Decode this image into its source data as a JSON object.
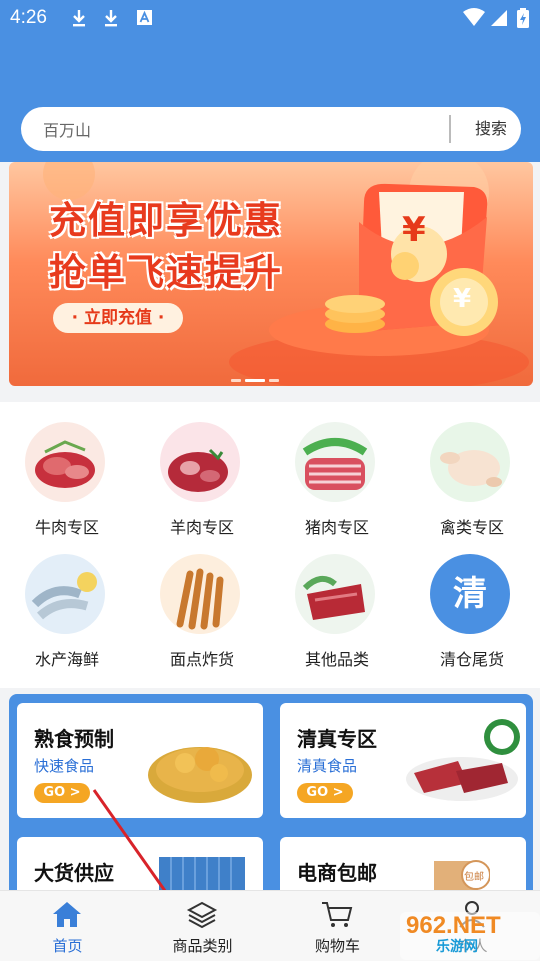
{
  "status_bar": {
    "time": "4:26",
    "icons": [
      "download-icon",
      "download-icon",
      "a-icon",
      "wifi-icon",
      "signal-icon",
      "battery-icon"
    ]
  },
  "search": {
    "placeholder": "百万山",
    "button": "搜索"
  },
  "banner": {
    "line1": "充值即享优惠",
    "line2": "抢单飞速提升",
    "cta": "· 立即充值 ·",
    "coin_symbol": "¥"
  },
  "categories": [
    {
      "label": "牛肉专区",
      "image": "beef-image"
    },
    {
      "label": "羊肉专区",
      "image": "lamb-image"
    },
    {
      "label": "猪肉专区",
      "image": "pork-image"
    },
    {
      "label": "禽类专区",
      "image": "poultry-image"
    },
    {
      "label": "水产海鲜",
      "image": "seafood-image"
    },
    {
      "label": "面点炸货",
      "image": "fried-food-image"
    },
    {
      "label": "其他品类",
      "image": "other-meat-image"
    },
    {
      "label": "清仓尾货",
      "icon_text": "清"
    }
  ],
  "cards": [
    {
      "title": "熟食预制",
      "subtitle": "快速食品",
      "go": "GO >"
    },
    {
      "title": "清真专区",
      "subtitle": "清真食品",
      "go": "GO >"
    },
    {
      "title": "大货供应"
    },
    {
      "title": "电商包邮",
      "badge": "包邮"
    }
  ],
  "tabbar": [
    {
      "label": "首页",
      "icon": "home-icon",
      "active": true
    },
    {
      "label": "商品类别",
      "icon": "layers-icon"
    },
    {
      "label": "购物车",
      "icon": "cart-icon"
    },
    {
      "label": "个人",
      "icon": "user-icon"
    }
  ],
  "watermark": "962.NET 乐游网",
  "colors": {
    "header": "#4a90e2",
    "accent_text": "#2a6fd6",
    "go_badge": "#f5a623",
    "banner_text": "#e83a1e"
  }
}
